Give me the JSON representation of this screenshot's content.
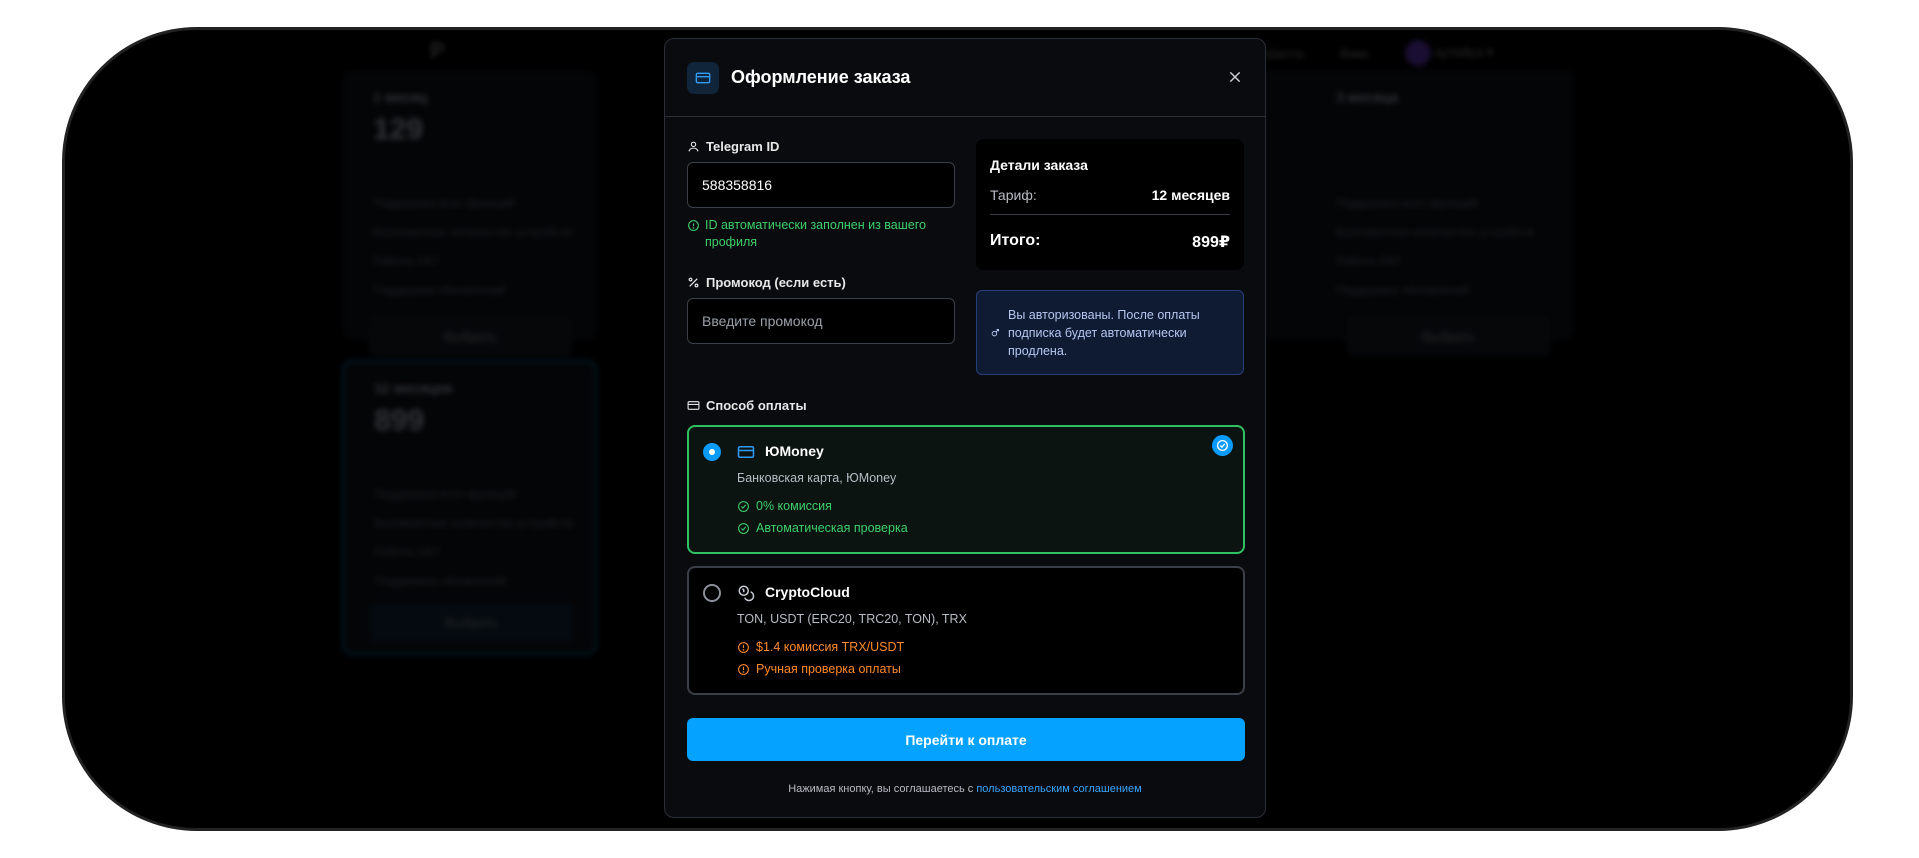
{
  "background": {
    "logo": "P",
    "nav": [
      "Шалта",
      "Вики"
    ],
    "user_name": "aySidlya",
    "plans": [
      {
        "title": "1 месяц",
        "price": "129",
        "features": [
          "Поддержка всех функций",
          "Безлимитное количество устройств",
          "Работа 24/7",
          "Поддержка обновлений"
        ],
        "button": "Выбрать"
      },
      {
        "title": "12 месяцев",
        "price": "899",
        "features": [
          "Поддержка всех функций",
          "Безлимитное количество устройств",
          "Работа 24/7",
          "Поддержка обновлений"
        ],
        "button": "Выбрать"
      }
    ],
    "right_plan": {
      "title": "3 месяца",
      "features": [
        "Поддержка всех функций",
        "Безлимитное количество устройств",
        "Работа 24/7",
        "Поддержка обновлений"
      ],
      "button": "Выбрать"
    }
  },
  "modal": {
    "title": "Оформление заказа",
    "telegram": {
      "label": "Telegram ID",
      "value": "588358816",
      "hint": "ID автоматически заполнен из вашего профиля"
    },
    "promo": {
      "label": "Промокод (если есть)",
      "placeholder": "Введите промокод"
    },
    "order": {
      "title": "Детали заказа",
      "tariff_label": "Тариф:",
      "tariff_value": "12 месяцев",
      "total_label": "Итого:",
      "total_value": "899₽"
    },
    "auth_notice": "Вы авторизованы. После оплаты подписка будет автоматически продлена.",
    "payment": {
      "label": "Способ оплаты",
      "methods": [
        {
          "name": "ЮMoney",
          "desc": "Банковская карта, ЮMoney",
          "features": [
            "0% комиссия",
            "Автоматическая проверка"
          ],
          "selected": true
        },
        {
          "name": "CryptoCloud",
          "desc": "TON, USDT (ERC20, TRC20, TON), TRX",
          "features": [
            "$1.4 комиссия TRX/USDT",
            "Ручная проверка оплаты"
          ],
          "selected": false
        }
      ]
    },
    "submit_label": "Перейти к оплате",
    "terms_text": "Нажимая кнопку, вы соглашаетесь с",
    "terms_link": "пользовательским соглашением"
  },
  "colors": {
    "accent": "#05a2ff",
    "success": "#2fc061",
    "warning": "#ff8a2a",
    "modal_bg": "#0a0b0f"
  },
  "icons": {
    "header": "credit-card-icon",
    "close": "close-icon",
    "telegram": "user-icon",
    "promo": "percent-icon",
    "payment": "credit-card-icon",
    "yoomoney": "credit-card-icon",
    "crypto": "coins-icon",
    "check": "check-circle-icon",
    "warning": "alert-circle-icon",
    "info": "info-icon"
  }
}
